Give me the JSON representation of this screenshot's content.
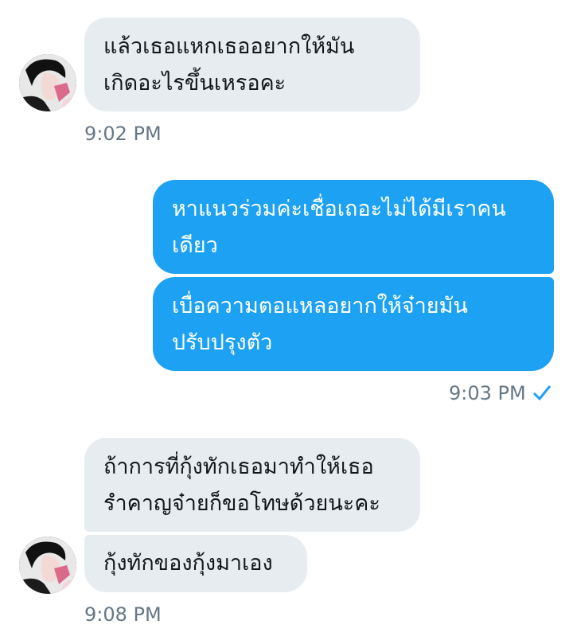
{
  "messages": [
    {
      "direction": "incoming",
      "lines": [
        "แล้วเธอแหกเธออยากให้มัน",
        "เกิดอะไรขึ้นเหรอคะ"
      ]
    },
    {
      "direction": "outgoing",
      "lines": [
        "หาแนวร่วมค่ะเชื่อเถอะไม่ได้มีเราคน",
        "เดียว"
      ]
    },
    {
      "direction": "outgoing",
      "lines": [
        "เบื่อความตอแหลอยากให้จ๋ายมัน",
        "ปรับปรุงตัว"
      ]
    },
    {
      "direction": "incoming",
      "lines": [
        "ถ้าการที่กุ้งทักเธอมาทำให้เธอ",
        "รำคาญจ๋ายก็ขอโทษด้วยนะคะ"
      ]
    },
    {
      "direction": "incoming",
      "lines": [
        "กุ้งทักของกุ้งมาเอง"
      ]
    }
  ],
  "timestamps": {
    "first": "9:02 PM",
    "second": "9:03 PM",
    "third": "9:08 PM"
  },
  "icons": {
    "avatar": "contact-avatar",
    "read_receipt": "check-icon"
  },
  "colors": {
    "incoming_bubble": "#e6ecf0",
    "outgoing_bubble": "#1da1f2",
    "timestamp": "#657786",
    "check": "#1da1f2"
  }
}
